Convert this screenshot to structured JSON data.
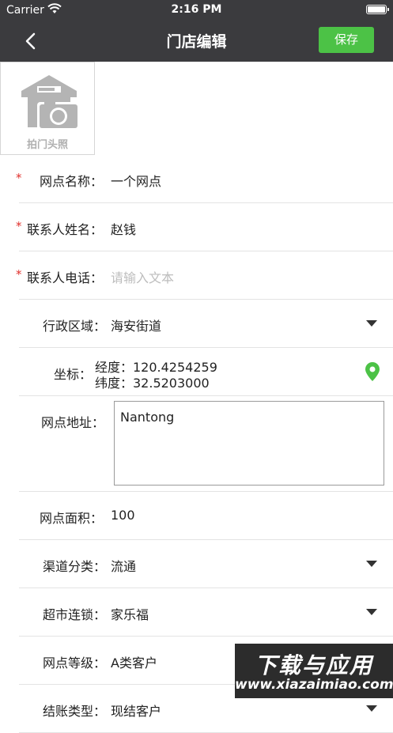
{
  "status_bar": {
    "carrier": "Carrier",
    "time": "2:16 PM"
  },
  "nav": {
    "title": "门店编辑",
    "save_label": "保存"
  },
  "photo": {
    "label": "拍门头照"
  },
  "form": {
    "name": {
      "required_mark": "*",
      "label": "网点名称：",
      "value": "一个网点"
    },
    "contact_name": {
      "required_mark": "*",
      "label": "联系人姓名：",
      "value": "赵钱"
    },
    "contact_phone": {
      "required_mark": "*",
      "label": "联系人电话：",
      "placeholder": "请输入文本"
    },
    "region": {
      "label": "行政区域：",
      "value": "海安街道"
    },
    "coordinates": {
      "label": "坐标：",
      "longitude": "经度：120.4254259",
      "latitude": "纬度：32.5203000"
    },
    "address": {
      "label": "网点地址：",
      "value": "Nantong"
    },
    "area": {
      "label": "网点面积：",
      "value": "100"
    },
    "channel": {
      "label": "渠道分类：",
      "value": "流通"
    },
    "chain": {
      "label": "超市连锁：",
      "value": "家乐福"
    },
    "grade": {
      "label": "网点等级：",
      "value": "A类客户"
    },
    "settlement": {
      "label": "结账类型：",
      "value": "现结客户"
    }
  },
  "watermark": {
    "line1": "下载与应用",
    "line2": "www.xiazaimiao.com"
  },
  "colors": {
    "nav_bg": "#3b3b3e",
    "save_bg": "#4cc246",
    "required": "#e0302d",
    "pin": "#4cc246"
  }
}
